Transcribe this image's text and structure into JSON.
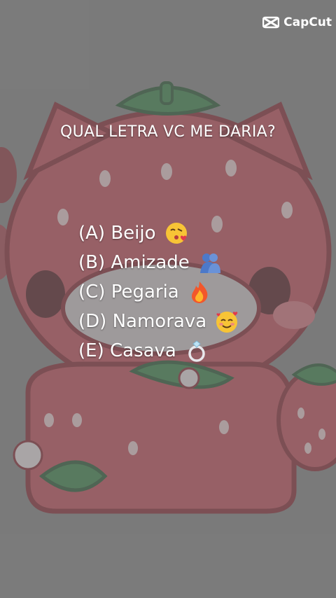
{
  "watermark": {
    "brand": "CapCut",
    "logo_icon": "capcut-logo-icon"
  },
  "question": "QUAL LETRA VC ME DARIA?",
  "options": [
    {
      "label": "(A) Beijo",
      "emoji": "kiss-face-icon"
    },
    {
      "label": "(B) Amizade",
      "emoji": "people-hugging-icon"
    },
    {
      "label": "(C) Pegaria",
      "emoji": "fire-icon"
    },
    {
      "label": "(D) Namorava",
      "emoji": "smiling-hearts-face-icon"
    },
    {
      "label": "(E) Casava",
      "emoji": "ring-icon"
    }
  ],
  "colors": {
    "background_gray": "#6f6f6f",
    "strawberry_red": "#c24a56",
    "leaf_green": "#3f8a4f",
    "text": "#ffffff"
  }
}
